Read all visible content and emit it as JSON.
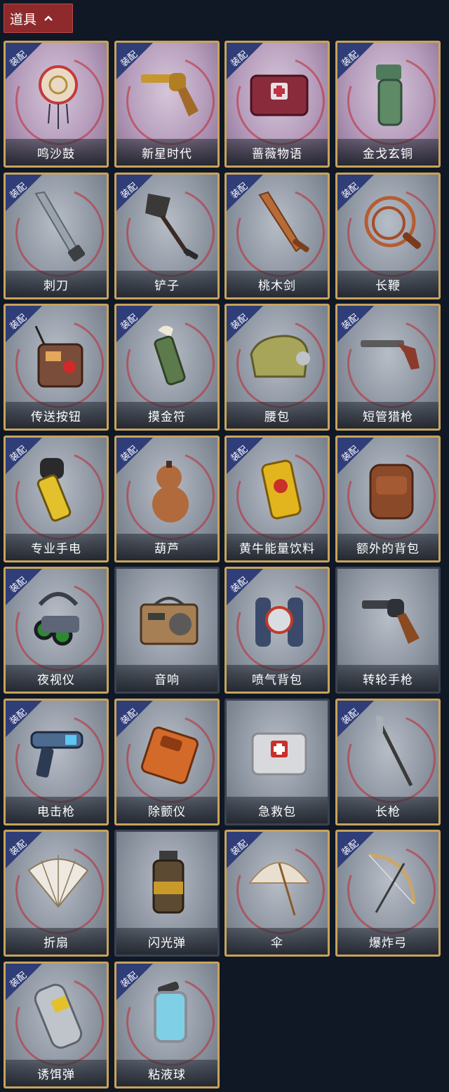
{
  "header": {
    "label": "道具"
  },
  "equip_badge_label": "装配",
  "items": [
    {
      "name": "鸣沙鼓",
      "icon": "dreamcatcher-drum-icon",
      "equipped": true,
      "style": "purple"
    },
    {
      "name": "新星时代",
      "icon": "revolver-gold-icon",
      "equipped": true,
      "style": "purple"
    },
    {
      "name": "蔷薇物语",
      "icon": "medkit-rose-icon",
      "equipped": true,
      "style": "purple"
    },
    {
      "name": "金戈玄铜",
      "icon": "bronze-grenade-icon",
      "equipped": true,
      "style": "purple"
    },
    {
      "name": "刺刀",
      "icon": "bayonet-icon",
      "equipped": true,
      "style": "grey"
    },
    {
      "name": "铲子",
      "icon": "shovel-icon",
      "equipped": true,
      "style": "grey"
    },
    {
      "name": "桃木剑",
      "icon": "wooden-sword-icon",
      "equipped": true,
      "style": "grey"
    },
    {
      "name": "长鞭",
      "icon": "whip-icon",
      "equipped": true,
      "style": "grey"
    },
    {
      "name": "传送按钮",
      "icon": "teleport-button-icon",
      "equipped": true,
      "style": "grey"
    },
    {
      "name": "摸金符",
      "icon": "talisman-icon",
      "equipped": true,
      "style": "grey"
    },
    {
      "name": "腰包",
      "icon": "waist-bag-icon",
      "equipped": true,
      "style": "grey"
    },
    {
      "name": "短管猎枪",
      "icon": "shotgun-icon",
      "equipped": true,
      "style": "grey"
    },
    {
      "name": "专业手电",
      "icon": "flashlight-icon",
      "equipped": true,
      "style": "grey"
    },
    {
      "name": "葫芦",
      "icon": "gourd-icon",
      "equipped": true,
      "style": "grey"
    },
    {
      "name": "黄牛能量饮料",
      "icon": "energy-drink-icon",
      "equipped": true,
      "style": "grey"
    },
    {
      "name": "额外的背包",
      "icon": "backpack-icon",
      "equipped": true,
      "style": "grey"
    },
    {
      "name": "夜视仪",
      "icon": "night-vision-goggles-icon",
      "equipped": true,
      "style": "grey"
    },
    {
      "name": "音响",
      "icon": "radio-speaker-icon",
      "equipped": false,
      "style": "grey"
    },
    {
      "name": "喷气背包",
      "icon": "jetpack-icon",
      "equipped": true,
      "style": "grey"
    },
    {
      "name": "转轮手枪",
      "icon": "revolver-icon",
      "equipped": false,
      "style": "grey"
    },
    {
      "name": "电击枪",
      "icon": "shock-gun-icon",
      "equipped": true,
      "style": "grey"
    },
    {
      "name": "除颤仪",
      "icon": "defibrillator-icon",
      "equipped": true,
      "style": "grey"
    },
    {
      "name": "急救包",
      "icon": "first-aid-kit-icon",
      "equipped": false,
      "style": "grey"
    },
    {
      "name": "长枪",
      "icon": "spear-icon",
      "equipped": true,
      "style": "grey"
    },
    {
      "name": "折扇",
      "icon": "folding-fan-icon",
      "equipped": true,
      "style": "grey"
    },
    {
      "name": "闪光弹",
      "icon": "flashbang-icon",
      "equipped": false,
      "style": "grey"
    },
    {
      "name": "伞",
      "icon": "umbrella-icon",
      "equipped": true,
      "style": "grey"
    },
    {
      "name": "爆炸弓",
      "icon": "explosive-bow-icon",
      "equipped": true,
      "style": "grey"
    },
    {
      "name": "诱饵弹",
      "icon": "decoy-canister-icon",
      "equipped": true,
      "style": "grey"
    },
    {
      "name": "粘液球",
      "icon": "slime-capsule-icon",
      "equipped": true,
      "style": "grey"
    }
  ],
  "colors": {
    "background": "#101826",
    "header_button": "#8e2a2c",
    "gold_frame": "#c8a35a",
    "badge_blue": "#2f3d78",
    "red_ring": "#be2832"
  }
}
